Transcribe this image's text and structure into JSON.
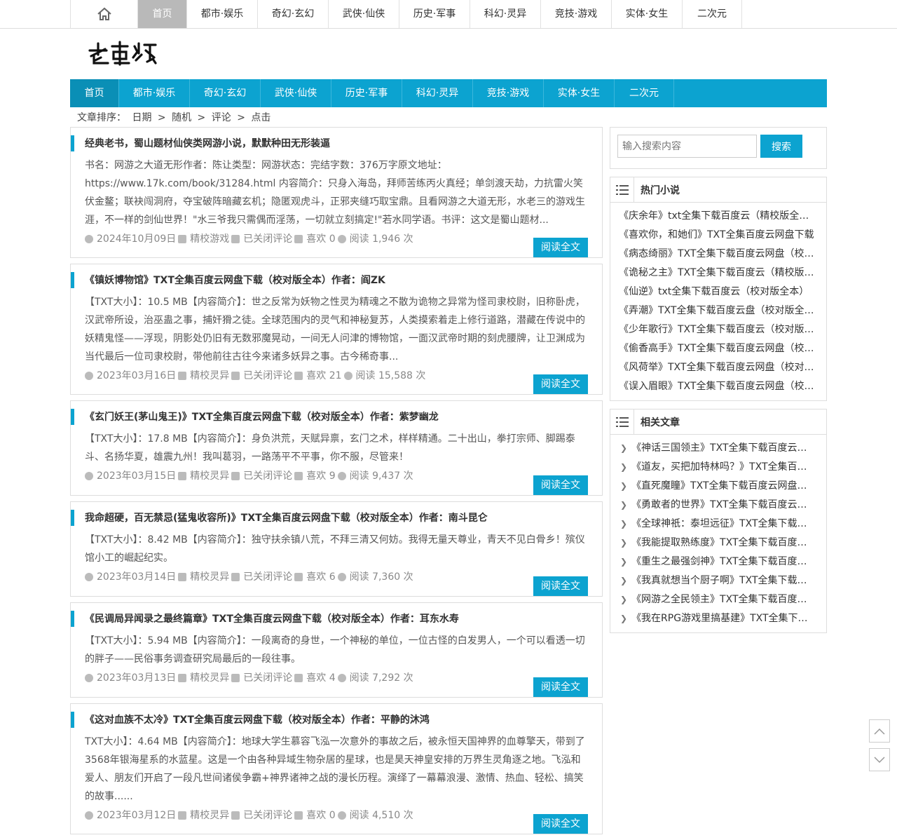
{
  "top_nav": {
    "items": [
      "首页",
      "都市·娱乐",
      "奇幻·玄幻",
      "武侠·仙侠",
      "历史·军事",
      "科幻·灵异",
      "竞技·游戏",
      "实体·女生",
      "二次元"
    ]
  },
  "logo_text": "老书虫",
  "main_nav": {
    "items": [
      "首页",
      "都市·娱乐",
      "奇幻·玄幻",
      "武侠·仙侠",
      "历史·军事",
      "科幻·灵异",
      "竞技·游戏",
      "实体·女生",
      "二次元"
    ]
  },
  "sort": {
    "label": "文章排序：",
    "options": [
      "日期",
      "随机",
      "评论",
      "点击"
    ],
    "sep": ">"
  },
  "posts": [
    {
      "title": "经典老书，蜀山题材仙侠类网游小说，默默种田无形装逼",
      "body": "书名：网游之大道无形作者：陈让类型：网游状态：完结字数：376万字原文地址：https://www.17k.com/book/31284.html 内容简介：只身入海岛，拜师苦练丙火真经；单剑渡天劫，力抗雷火笑伏金鳌；联袂闯洞府，夺宝破阵暗藏玄机；隐匿观虎斗，正邪夹缝巧取宝鼎。且看网游之大道无形，水老三的游戏生涯，不一样的剑仙世界！\"水三爷我只需偶而淫荡，一切就立刻搞定!\"若水同学语。书评：这文是蜀山题材...",
      "date": "2024年10月09日",
      "category": "精校游戏",
      "comments": "已关闭评论",
      "likes": "喜欢 0",
      "views": "阅读 1,946 次",
      "read_more": "阅读全文"
    },
    {
      "title": "《镇妖博物馆》TXT全集百度云网盘下载（校对版全本）作者：阎ZK",
      "body": "【TXT大小】：10.5 MB【内容简介】：世之反常为妖物之性灵为精魂之不散为诡物之异常为怪司隶校尉，旧称卧虎，汉武帝所设，治巫蛊之事，捕奸猾之徒。全球范围内的灵气和神秘复苏，人类摸索着走上修行道路，潜藏在传说中的妖精鬼怪——浮现，阴影处仍旧有无数邪魔晃动，一间无人问津的博物馆，一面汉武帝时期的刻虎腰牌，让卫渊成为当代最后一位司隶校尉，带他前往古往今来诸多妖异之事。古今稀奇事...",
      "date": "2023年03月16日",
      "category": "精校灵异",
      "comments": "已关闭评论",
      "likes": "喜欢 21",
      "views": "阅读 15,588 次",
      "read_more": "阅读全文"
    },
    {
      "title": "《玄门妖王(茅山鬼王)》TXT全集百度云网盘下载（校对版全本）作者：紫梦幽龙",
      "body": "【TXT大小】：17.8 MB【内容简介】：身负洪荒，天赋异禀，玄门之术，样样精通。二十出山，拳打宗师、脚踢泰斗、名扬华夏，雄震九州！我叫葛羽，一路荡平不平事，你不服，尽管来！",
      "date": "2023年03月15日",
      "category": "精校灵异",
      "comments": "已关闭评论",
      "likes": "喜欢 9",
      "views": "阅读 9,437 次",
      "read_more": "阅读全文"
    },
    {
      "title": "我命超硬，百无禁忌(猛鬼收容所)》TXT全集百度云网盘下载（校对版全本）作者：南斗昆仑",
      "body": "【TXT大小】：8.42 MB【内容简介】：独守扶余镇八荒，不拜三清又何妨。我得无量天尊业，青天不见白骨乡！殡仪馆小工的崛起纪实。",
      "date": "2023年03月14日",
      "category": "精校灵异",
      "comments": "已关闭评论",
      "likes": "喜欢 6",
      "views": "阅读 7,360 次",
      "read_more": "阅读全文"
    },
    {
      "title": "《民调局异闻录之最终篇章》TXT全集百度云网盘下载（校对版全本）作者：耳东水寿",
      "body": "【TXT大小】：5.94 MB【内容简介】：一段离奇的身世，一个神秘的单位，一位古怪的白发男人，一个可以看透一切的胖子——民俗事务调查研究局最后的一段往事。",
      "date": "2023年03月13日",
      "category": "精校灵异",
      "comments": "已关闭评论",
      "likes": "喜欢 4",
      "views": "阅读 7,292 次",
      "read_more": "阅读全文"
    },
    {
      "title": "《这对血族不太冷》TXT全集百度云网盘下载（校对版全本）作者：平静的沐鸿",
      "body": "TXT大小】：4.64 MB【内容简介】：地球大学生慕容飞泓一次意外的事故之后，被永恒天国神界的血尊擎天，带到了3568年银海星系的水蓝星。这是一个由各种异域生物杂居的星球，也是昊天神皇安排的万界生灵角逐之地。飞泓和爱人、朋友们开启了一段凡世间诸侯争霸+神界诸神之战的漫长历程。演绎了一幕幕浪漫、激情、热血、轻松、搞笑的故事......",
      "date": "2023年03月12日",
      "category": "精校灵异",
      "comments": "已关闭评论",
      "likes": "喜欢 0",
      "views": "阅读 4,510 次",
      "read_more": "阅读全文"
    }
  ],
  "search": {
    "placeholder": "输入搜索内容",
    "button": "搜索"
  },
  "hot": {
    "title": "热门小说",
    "items": [
      "《庆余年》txt全集下载百度云（精校版全本）",
      "《喜欢你，和她们》TXT全集百度云网盘下载",
      "《病态绮丽》TXT全集下载百度云网盘（校对版）",
      "《诡秘之主》TXT全集下载百度云（精校版全本）",
      "《仙逆》txt全集下载百度云（校对版全本）",
      "《弄潮》TXT全集下载百度云盘（校对版全本）",
      "《少年歌行》TXT全集下载百度云（校对版全本）",
      "《偷香高手》TXT全集下载百度云网盘（校对版）",
      "《风荷举》TXT全集下载百度云网盘（校对版全本）",
      "《误入眉眼》TXT全集下载百度云网盘（校对版）"
    ]
  },
  "related": {
    "title": "相关文章",
    "items": [
      "《神话三国领主》TXT全集下载百度云网盘（校对版）",
      "《道友，买把加特林吗？》TXT全集百度云网盘",
      "《直死魔瞳》TXT全集下载百度云网盘（校对版）",
      "《勇敢者的世界》TXT全集下载百度云网盘",
      "《全球神祇：泰坦远征》TXT全集下载百度云",
      "《我能提取熟练度》TXT全集下载百度云网盘",
      "《重生之最强剑神》TXT全集下载百度云网盘",
      "《我真就想当个厨子啊》TXT全集下载百度云",
      "《网游之全民领主》TXT全集下载百度云网盘",
      "《我在RPG游戏里搞基建》TXT全集下载百度云"
    ]
  },
  "colors": {
    "accent": "#0ca3d0",
    "top_active": "#b9b9b9"
  }
}
